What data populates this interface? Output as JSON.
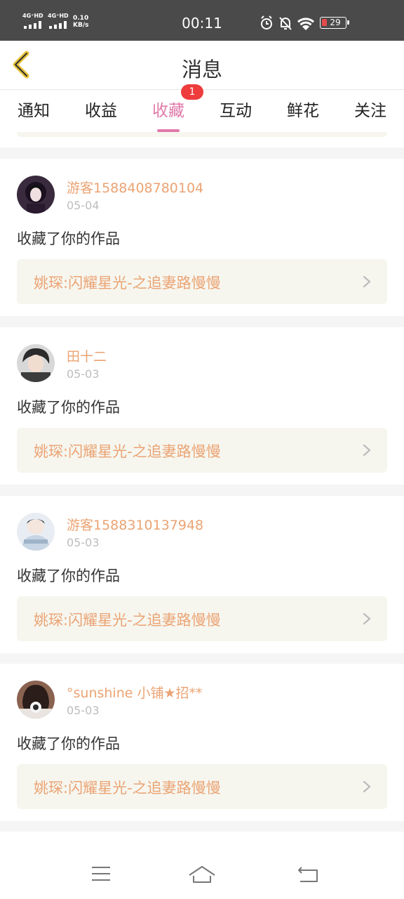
{
  "status_bar": {
    "net1": "4G⁺HD",
    "net2": "4G⁺HD",
    "speed_value": "0.10",
    "speed_unit": "KB/s",
    "time": "00:11",
    "battery": "29"
  },
  "header": {
    "title": "消息"
  },
  "tabs": [
    {
      "label": "通知"
    },
    {
      "label": "收益"
    },
    {
      "label": "收藏"
    },
    {
      "label": "互动"
    },
    {
      "label": "鲜花"
    },
    {
      "label": "关注"
    }
  ],
  "active_tab": "收藏",
  "tab_badge": "1",
  "messages": [
    {
      "username": "游客1588408780104",
      "date": "05-04",
      "action": "收藏了你的作品",
      "work_title": "姚琛:闪耀星光-之追妻路慢慢"
    },
    {
      "username": "田十二",
      "date": "05-03",
      "action": "收藏了你的作品",
      "work_title": "姚琛:闪耀星光-之追妻路慢慢"
    },
    {
      "username": "游客1588310137948",
      "date": "05-03",
      "action": "收藏了你的作品",
      "work_title": "姚琛:闪耀星光-之追妻路慢慢"
    },
    {
      "username": "°sunshine 小铺★招**",
      "date": "05-03",
      "action": "收藏了你的作品",
      "work_title": "姚琛:闪耀星光-之追妻路慢慢"
    }
  ],
  "colors": {
    "accent_pink": "#e07aa9",
    "name_orange": "#eba373",
    "badge_red": "#ee3b3b",
    "back_arrow_yellow": "#e8c33a"
  },
  "icons": [
    "back-arrow-icon",
    "alarm-icon",
    "bell-off-icon",
    "wifi-icon",
    "battery-icon",
    "chevron-right-icon",
    "menu-icon",
    "home-icon",
    "return-icon"
  ]
}
